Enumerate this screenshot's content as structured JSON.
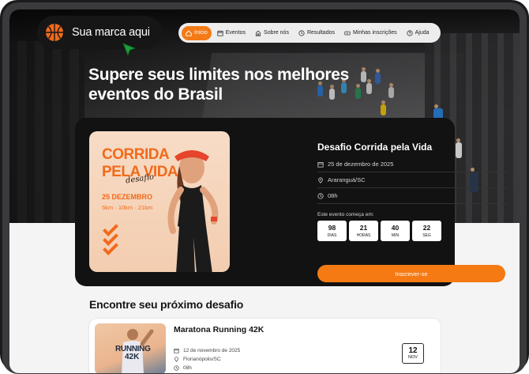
{
  "brand": {
    "name": "Sua marca aqui",
    "accent": "#f57a13",
    "logo_icon": "basketball-icon"
  },
  "nav": [
    {
      "label": "Início",
      "icon": "home-icon",
      "active": true
    },
    {
      "label": "Eventos",
      "icon": "calendar-icon",
      "active": false
    },
    {
      "label": "Sobre nós",
      "icon": "building-icon",
      "active": false
    },
    {
      "label": "Resultados",
      "icon": "clock-icon",
      "active": false
    },
    {
      "label": "Minhas inscrições",
      "icon": "ticket-icon",
      "active": false
    },
    {
      "label": "Ajuda",
      "icon": "help-icon",
      "active": false
    }
  ],
  "hero": {
    "headline_line1": "Supere seus limites nos melhores",
    "headline_line2": "eventos do Brasil"
  },
  "featured_event": {
    "poster": {
      "line1": "CORRIDA",
      "line2": "PELA VIDA",
      "script": "desafio",
      "date": "25 DEZEMBRO",
      "distances": "5km · 10km · 21km"
    },
    "title": "Desafio Corrida pela Vida",
    "date": "25 de dezembro de 2025",
    "location": "Araranguá/SC",
    "time": "08h",
    "countdown_label": "Este evento começa em:",
    "countdown": [
      {
        "value": "98",
        "unit": "DIAS"
      },
      {
        "value": "21",
        "unit": "HORAS"
      },
      {
        "value": "40",
        "unit": "MIN"
      },
      {
        "value": "22",
        "unit": "SEG"
      }
    ],
    "cta_label": "Inscrever-se"
  },
  "events_section": {
    "title": "Encontre seu próximo desafio",
    "items": [
      {
        "poster_line1": "RUNNING",
        "poster_line2": "42K",
        "title": "Maratona Running 42K",
        "date": "12 de novembro de 2025",
        "location": "Florianópolis/SC",
        "time": "08h",
        "badge_day": "12",
        "badge_month": "NOV"
      }
    ]
  }
}
